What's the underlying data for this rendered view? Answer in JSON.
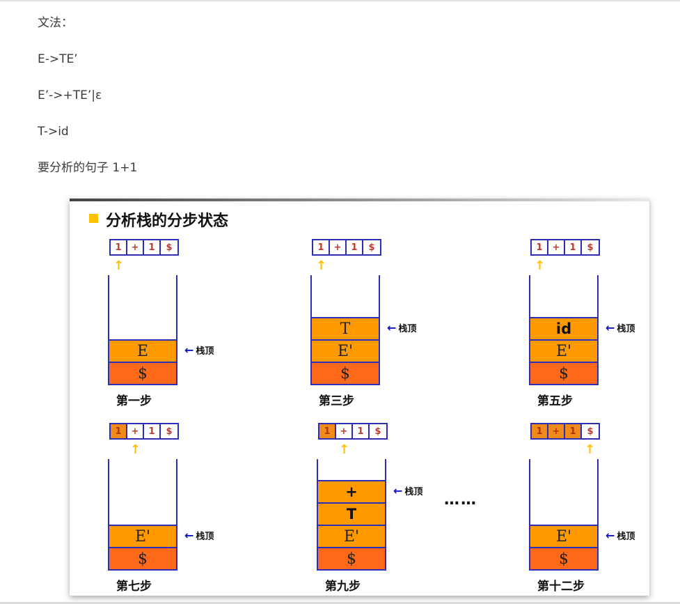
{
  "grammar": {
    "heading": "文法：",
    "rule1": "E->TE’",
    "rule2": "E’->+TE’|ε",
    "rule3": "T->id",
    "sentence": "要分析的句子 1+1"
  },
  "figure": {
    "title": "分析栈的分步状态",
    "top_label": "栈顶",
    "ellipsis": "……",
    "panels": [
      {
        "step": "第一步",
        "input": [
          {
            "sym": "1",
            "consumed": false
          },
          {
            "sym": "+",
            "consumed": false
          },
          {
            "sym": "1",
            "consumed": false
          },
          {
            "sym": "$",
            "consumed": false
          }
        ],
        "pointer_index": 0,
        "stack": [
          "E",
          "$"
        ]
      },
      {
        "step": "第三步",
        "input": [
          {
            "sym": "1",
            "consumed": false
          },
          {
            "sym": "+",
            "consumed": false
          },
          {
            "sym": "1",
            "consumed": false
          },
          {
            "sym": "$",
            "consumed": false
          }
        ],
        "pointer_index": 0,
        "stack": [
          "T",
          "E'",
          "$"
        ]
      },
      {
        "step": "第五步",
        "input": [
          {
            "sym": "1",
            "consumed": false
          },
          {
            "sym": "+",
            "consumed": false
          },
          {
            "sym": "1",
            "consumed": false
          },
          {
            "sym": "$",
            "consumed": false
          }
        ],
        "pointer_index": 0,
        "stack": [
          "id",
          "E'",
          "$"
        ]
      },
      {
        "step": "第七步",
        "input": [
          {
            "sym": "1",
            "consumed": true
          },
          {
            "sym": "+",
            "consumed": false
          },
          {
            "sym": "1",
            "consumed": false
          },
          {
            "sym": "$",
            "consumed": false
          }
        ],
        "pointer_index": 1,
        "stack": [
          "E'",
          "$"
        ]
      },
      {
        "step": "第九步",
        "input": [
          {
            "sym": "1",
            "consumed": true
          },
          {
            "sym": "+",
            "consumed": false
          },
          {
            "sym": "1",
            "consumed": false
          },
          {
            "sym": "$",
            "consumed": false
          }
        ],
        "pointer_index": 1,
        "stack": [
          "+",
          "T",
          "E'",
          "$"
        ]
      },
      {
        "step": "第十二步",
        "input": [
          {
            "sym": "1",
            "consumed": true
          },
          {
            "sym": "+",
            "consumed": true
          },
          {
            "sym": "1",
            "consumed": true
          },
          {
            "sym": "$",
            "consumed": false
          }
        ],
        "pointer_index": 3,
        "stack": [
          "E'",
          "$"
        ]
      }
    ]
  }
}
